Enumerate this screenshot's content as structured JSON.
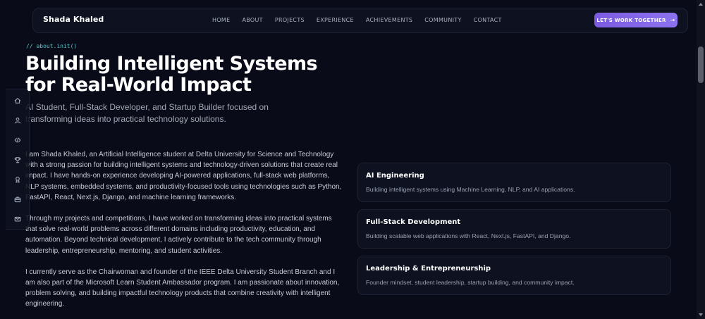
{
  "brand": "Shada Khaled",
  "nav": {
    "items": [
      "HOME",
      "ABOUT",
      "PROJECTS",
      "EXPERIENCE",
      "ACHIEVEMENTS",
      "COMMUNITY",
      "CONTACT"
    ],
    "cta_label": "LET'S WORK TOGETHER",
    "cta_arrow": "→"
  },
  "hero": {
    "code_tag": "// about.init()",
    "title_line1": "Building Intelligent Systems",
    "title_line2": "for Real-World Impact",
    "subtitle": "AI Student, Full-Stack Developer, and Startup Builder focused on transforming ideas into practical technology solutions."
  },
  "bio": {
    "p1": "I am Shada Khaled, an Artificial Intelligence student at Delta University for Science and Technology with a strong passion for building intelligent systems and technology-driven solutions that create real impact. I have hands-on experience developing AI-powered applications, full-stack web platforms, NLP systems, embedded systems, and productivity-focused tools using technologies such as Python, FastAPI, React, Next.js, Django, and machine learning frameworks.",
    "p2": "Through my projects and competitions, I have worked on transforming ideas into practical systems that solve real-world problems across different domains including productivity, education, and automation. Beyond technical development, I actively contribute to the tech community through leadership, entrepreneurship, mentoring, and student activities.",
    "p3": "I currently serve as the Chairwoman and founder of the IEEE Delta University Student Branch and I am also part of the Microsoft Learn Student Ambassador program. I am passionate about innovation, problem solving, and building impactful technology products that combine creativity with intelligent engineering."
  },
  "rail": {
    "icons": [
      "home-icon",
      "user-icon",
      "code-icon",
      "trophy-icon",
      "award-icon",
      "briefcase-icon",
      "mail-icon"
    ]
  },
  "cards": [
    {
      "title": "AI Engineering",
      "desc": "Building intelligent systems using Machine Learning, NLP, and AI applications."
    },
    {
      "title": "Full-Stack Development",
      "desc": "Building scalable web applications with React, Next.js, FastAPI, and Django."
    },
    {
      "title": "Leadership & Entrepreneurship",
      "desc": "Founder mindset, student leadership, startup building, and community impact."
    }
  ],
  "colors": {
    "background": "#090c18",
    "accent": "#8b72f0",
    "code_tag": "#5ec3c9"
  }
}
